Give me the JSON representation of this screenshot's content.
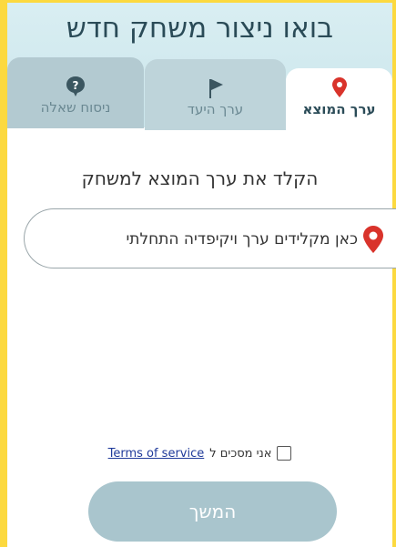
{
  "header": {
    "title": "בואו ניצור משחק חדש"
  },
  "tabs": [
    {
      "label": "ערך המוצא",
      "icon": "map-pin-icon",
      "active": true
    },
    {
      "label": "ערך היעד",
      "icon": "flag-icon",
      "active": false
    },
    {
      "label": "ניסוח שאלה",
      "icon": "question-icon",
      "active": false
    }
  ],
  "main": {
    "instruction": "הקלד את ערך המוצא למשחק",
    "input_placeholder": "כאן מקלידים ערך ויקיפדיה התחלתי",
    "terms_prefix": "אני מסכים ל",
    "terms_link": "Terms of service",
    "continue_label": "המשך"
  },
  "colors": {
    "frame": "#fcd93f",
    "header_bg": "#d9eef2",
    "pin_red": "#d9332b",
    "button_bg": "#a9c5cd"
  }
}
